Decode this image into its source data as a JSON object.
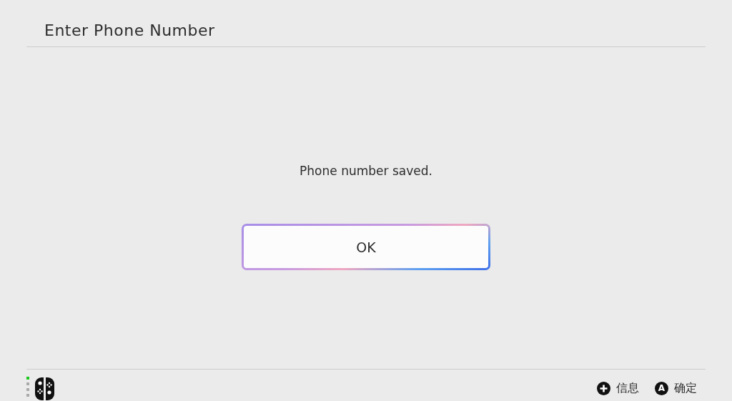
{
  "header": {
    "title": "Enter Phone Number"
  },
  "dialog": {
    "message": "Phone number saved.",
    "button": {
      "label": "OK",
      "focused": true
    }
  },
  "footer": {
    "actions": [
      {
        "kind": "plus",
        "label": "信息"
      },
      {
        "kind": "key",
        "key": "A",
        "label": "确定"
      }
    ]
  }
}
